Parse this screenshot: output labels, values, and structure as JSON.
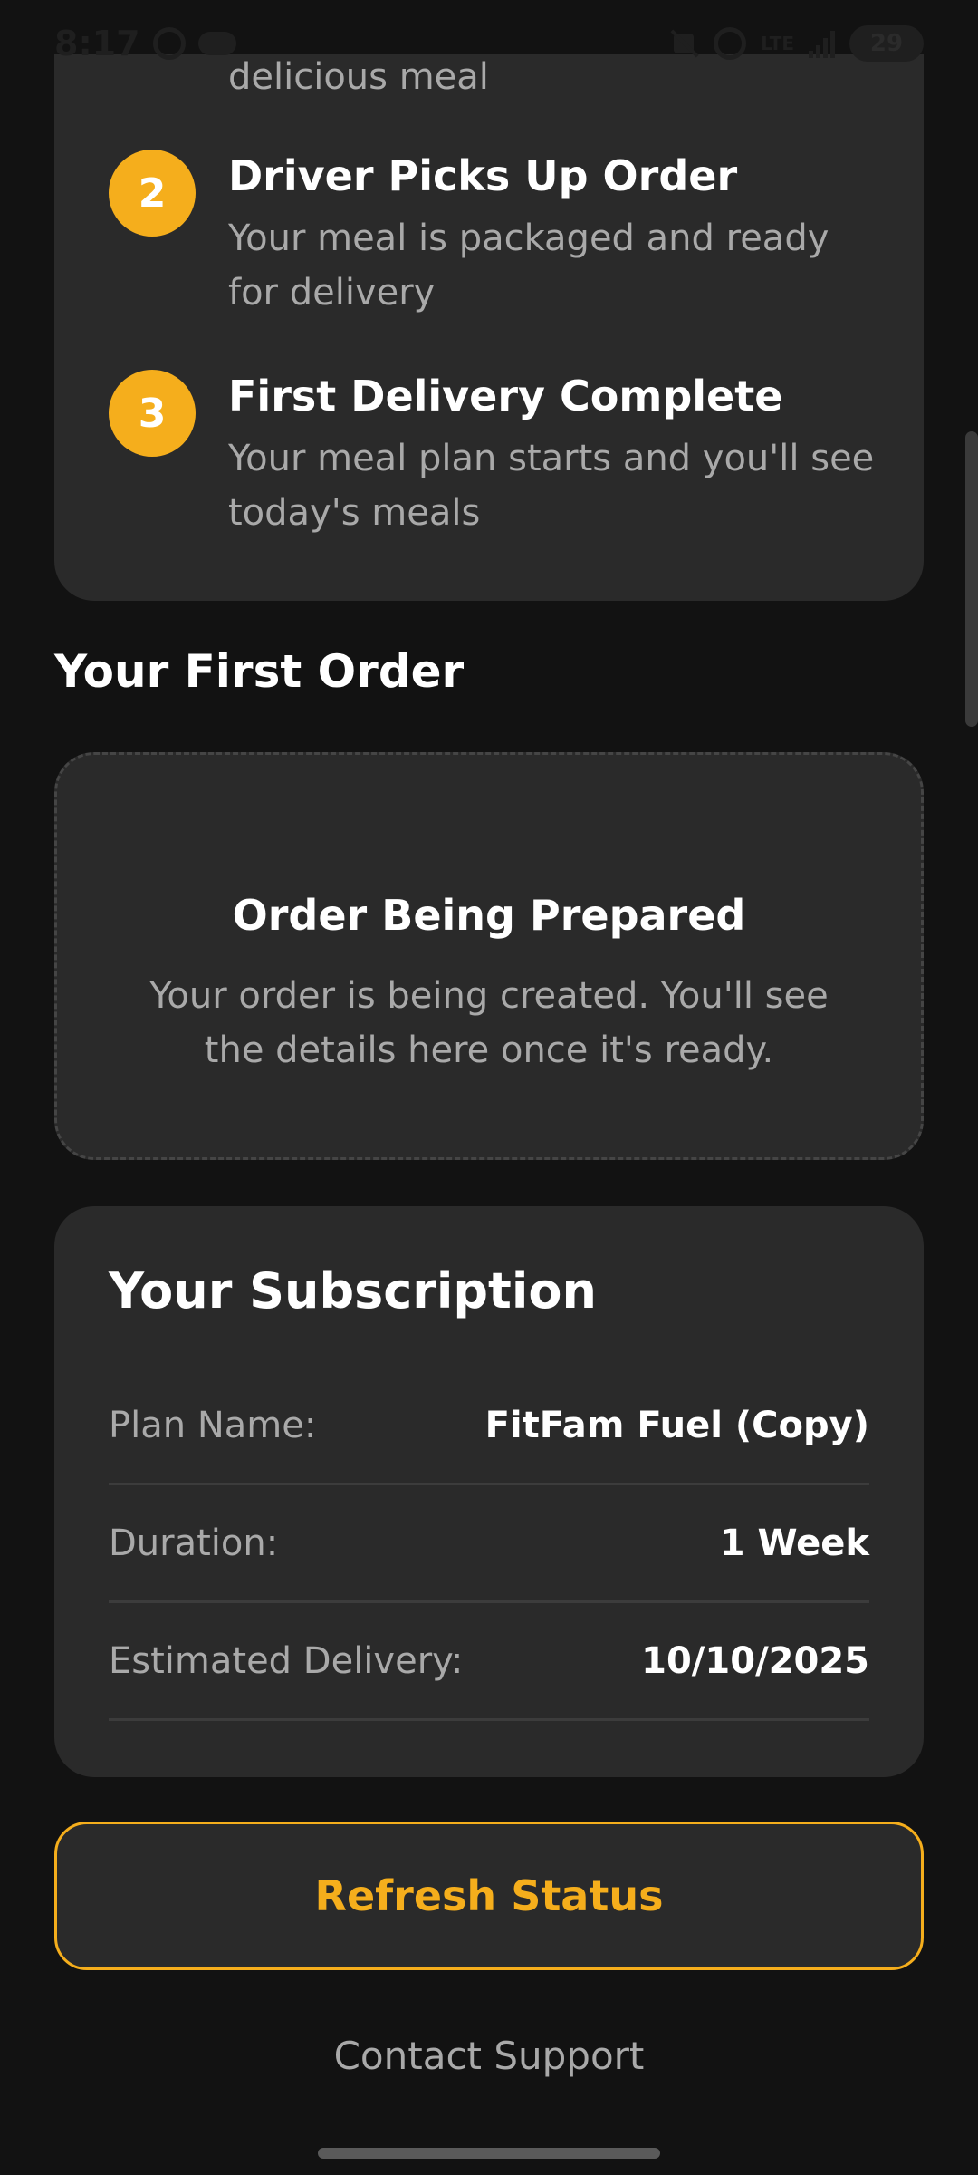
{
  "status_bar": {
    "time": "8:17",
    "lte_label": "LTE",
    "battery": "29"
  },
  "steps": {
    "cutoff_text": "delicious meal",
    "items": [
      {
        "number": "2",
        "title": "Driver Picks Up Order",
        "description": "Your meal is packaged and ready for delivery"
      },
      {
        "number": "3",
        "title": "First Delivery Complete",
        "description": "Your meal plan starts and you'll see today's meals"
      }
    ]
  },
  "first_order": {
    "heading": "Your First Order",
    "status_title": "Order Being Prepared",
    "status_description": "Your order is being created. You'll see the details here once it's ready."
  },
  "subscription": {
    "title": "Your Subscription",
    "rows": [
      {
        "label": "Plan Name:",
        "value": "FitFam Fuel (Copy)"
      },
      {
        "label": "Duration:",
        "value": "1 Week"
      },
      {
        "label": "Estimated Delivery:",
        "value": "10/10/2025"
      }
    ]
  },
  "actions": {
    "refresh_label": "Refresh Status",
    "contact_label": "Contact Support"
  },
  "colors": {
    "accent": "#f5ae1c",
    "background": "#121212",
    "card": "#2a2a2a",
    "muted_text": "#a9a9a9"
  }
}
